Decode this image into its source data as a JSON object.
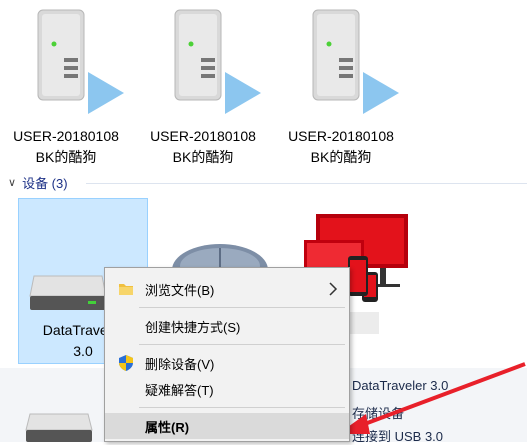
{
  "servers": [
    {
      "line1": "USER-20180108",
      "line2": "BK的酷狗"
    },
    {
      "line1": "USER-20180108",
      "line2": "BK的酷狗"
    },
    {
      "line1": "USER-20180108",
      "line2": "BK的酷狗"
    }
  ],
  "devices_group": {
    "title": "设备 (3)"
  },
  "selected_device": {
    "line1": "DataTraveler",
    "line2": "3.0"
  },
  "details": {
    "name": "DataTraveler 3.0",
    "category": "存储设备",
    "connection": "连接到 USB 3.0"
  },
  "context_menu": {
    "items": [
      {
        "label": "浏览文件(B)",
        "icon": "folder-icon",
        "has_submenu": true
      },
      {
        "label": "创建快捷方式(S)"
      },
      {
        "label": "删除设备(V)",
        "icon": "shield-icon"
      },
      {
        "label": "疑难解答(T)"
      },
      {
        "label": "属性(R)",
        "bold": true,
        "highlighted": true
      }
    ]
  },
  "colors": {
    "accent_arrow": "#e8202a",
    "selection": "#cce8ff",
    "monitor_red": "#e3121b"
  }
}
